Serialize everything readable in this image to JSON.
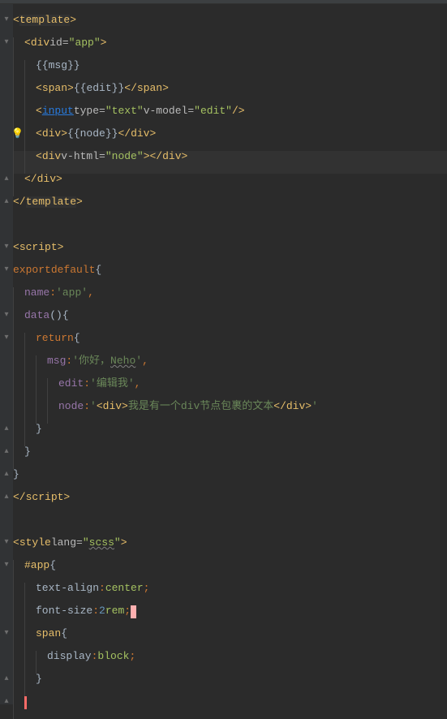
{
  "template": {
    "open": "template",
    "div_open": {
      "tag": "div",
      "id_attr": "id",
      "id_val": "app"
    },
    "msg_line": "{{msg}}",
    "span": {
      "tag": "span",
      "content": "{{edit}}"
    },
    "input": {
      "tag": "input",
      "type_attr": "type",
      "type_val": "text",
      "vmodel_attr": "v-model",
      "vmodel_val": "edit"
    },
    "node_div": {
      "tag": "div",
      "content": "{{node}}"
    },
    "vhtml_div": {
      "tag": "div",
      "vhtml_attr": "v-html",
      "vhtml_val": "node"
    },
    "div_close": "div",
    "close": "template"
  },
  "script": {
    "open": "script",
    "export": "export",
    "default": "default",
    "name_key": "name",
    "name_val": "app",
    "data_key": "data",
    "return_kw": "return",
    "msg_key": "msg",
    "msg_val_pre": "你好，",
    "msg_val_wavy": "Neho",
    "edit_key": "edit",
    "edit_val": "编辑我",
    "node_key": "node",
    "node_val_open": "<div>",
    "node_val_text": "我是有一个div节点包裹的文本",
    "node_val_close": "</div>",
    "close": "script"
  },
  "style": {
    "open": "style",
    "lang_attr": "lang",
    "lang_val": "scss",
    "selector_app": "#app",
    "prop_textalign": "text-align",
    "val_center": "center",
    "prop_fontsize": "font-size",
    "val_2": "2",
    "val_rem": "rem",
    "selector_span": "span",
    "prop_display": "display",
    "val_block": "block"
  }
}
